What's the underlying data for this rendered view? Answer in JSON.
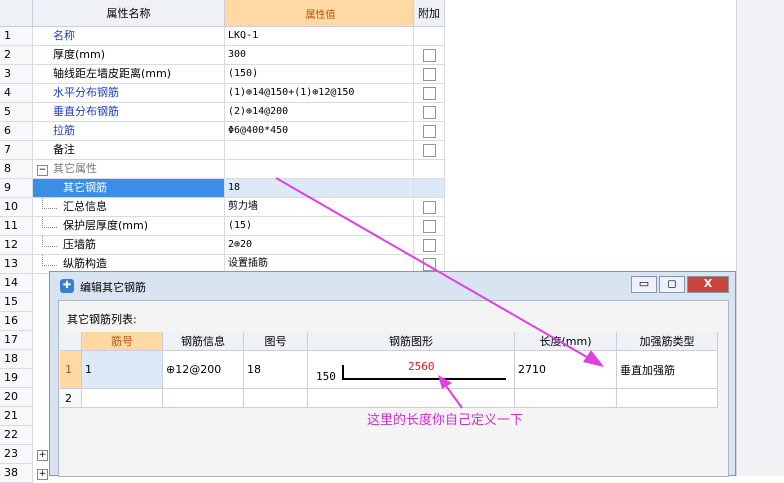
{
  "grid": {
    "header": {
      "name": "属性名称",
      "value": "属性值",
      "extra": "附加"
    },
    "rows": [
      {
        "num": "1",
        "name": "名称",
        "value": "LKQ-1",
        "style": "blue",
        "check": false
      },
      {
        "num": "2",
        "name": "厚度(mm)",
        "value": "300",
        "style": "",
        "check": true
      },
      {
        "num": "3",
        "name": "轴线距左墙皮距离(mm)",
        "value": "(150)",
        "style": "",
        "check": true
      },
      {
        "num": "4",
        "name": "水平分布钢筋",
        "value": "(1)⊕14@150+(1)⊕12@150",
        "style": "blue",
        "check": true
      },
      {
        "num": "5",
        "name": "垂直分布钢筋",
        "value": "(2)⊕14@200",
        "style": "blue",
        "check": true
      },
      {
        "num": "6",
        "name": "拉筋",
        "value": "Φ6@400*450",
        "style": "blue",
        "check": true
      },
      {
        "num": "7",
        "name": "备注",
        "value": "",
        "style": "",
        "check": true
      },
      {
        "num": "8",
        "name": "其它属性",
        "value": "",
        "style": "gray",
        "check": false
      },
      {
        "num": "9",
        "name": "其它钢筋",
        "value": "18",
        "style": "",
        "check": false
      },
      {
        "num": "10",
        "name": "汇总信息",
        "value": "剪力墙",
        "style": "",
        "check": true
      },
      {
        "num": "11",
        "name": "保护层厚度(mm)",
        "value": "(15)",
        "style": "",
        "check": true
      },
      {
        "num": "12",
        "name": "压墙筋",
        "value": "2⊕20",
        "style": "",
        "check": true
      },
      {
        "num": "13",
        "name": "纵筋构造",
        "value": "设置插筋",
        "style": "",
        "check": true
      },
      {
        "num": "14"
      },
      {
        "num": "15"
      },
      {
        "num": "16"
      },
      {
        "num": "17"
      },
      {
        "num": "18"
      },
      {
        "num": "19"
      },
      {
        "num": "20"
      },
      {
        "num": "21"
      },
      {
        "num": "22"
      },
      {
        "num": "23",
        "plus": "+"
      },
      {
        "num": "38",
        "plus": "+"
      }
    ]
  },
  "dialog": {
    "title": "编辑其它钢筋",
    "buttons": {
      "minimize": "▭",
      "maximize": "◻",
      "close": "X"
    },
    "caption": "其它钢筋列表:",
    "columns": [
      "",
      "筋号",
      "钢筋信息",
      "图号",
      "钢筋图形",
      "长度(mm)",
      "加强筋类型"
    ],
    "rows": [
      {
        "num": "1",
        "bar_no": "1",
        "info": "⊕12@200",
        "fig_no": "18",
        "shape_left": "150",
        "shape_mid": "2560",
        "length": "2710",
        "type": "垂直加强筋"
      },
      {
        "num": "2",
        "bar_no": "",
        "info": "",
        "fig_no": "",
        "shape_left": "",
        "shape_mid": "",
        "length": "",
        "type": ""
      }
    ]
  },
  "annotation": {
    "note": "这里的长度你自己定义一下",
    "color": "#cc33cc"
  }
}
